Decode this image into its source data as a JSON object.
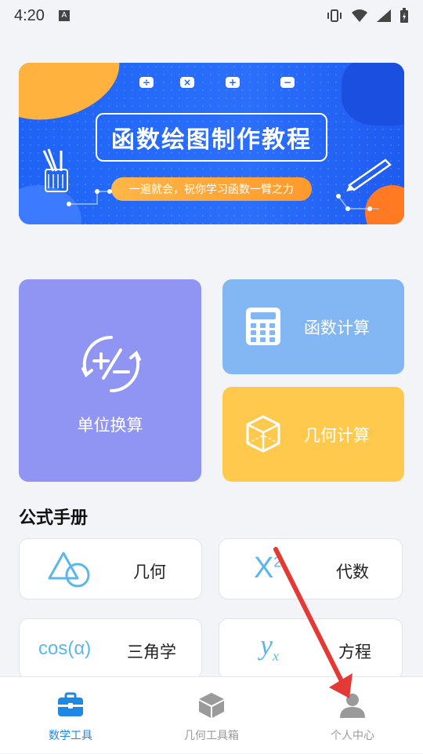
{
  "status": {
    "time": "4:20",
    "notif": "A"
  },
  "banner": {
    "title": "函数绘图制作教程",
    "subtitle": "一遍就会，祝你学习函数一臂之力",
    "ops": [
      "÷",
      "×",
      "+",
      "−"
    ]
  },
  "cards": {
    "unit_label": "单位换算",
    "func_label": "函数计算",
    "geo_label": "几何计算"
  },
  "formula": {
    "section_title": "公式手册",
    "items": [
      {
        "label": "几何",
        "icon": "triangle-circle-icon"
      },
      {
        "label": "代数",
        "icon_text": "X",
        "icon_sup": "2"
      },
      {
        "label": "三角学",
        "icon_text": "cos(α)"
      },
      {
        "label": "方程",
        "icon_text": "y",
        "icon_sub": "x"
      }
    ]
  },
  "tabs": [
    {
      "label": "数学工具",
      "icon": "toolbox-icon"
    },
    {
      "label": "几何工具箱",
      "icon": "cube-icon"
    },
    {
      "label": "个人中心",
      "icon": "person-icon"
    }
  ],
  "colors": {
    "banner": "#1f63f6",
    "unit": "#9094f3",
    "func": "#82b7f3",
    "geo": "#ffc94e",
    "active_tab": "#1e88e5",
    "annotation_arrow": "#e53935"
  }
}
